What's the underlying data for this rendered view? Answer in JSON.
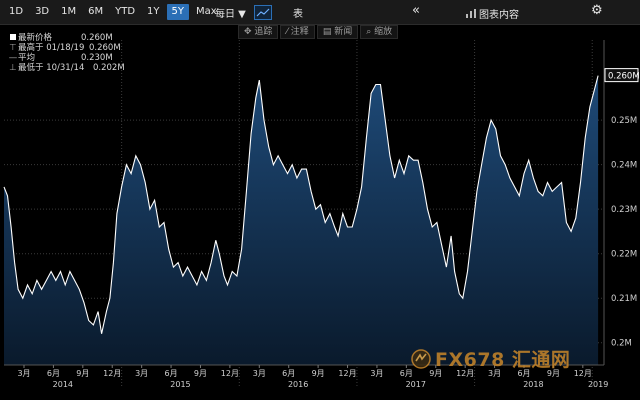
{
  "toolbar": {
    "ranges": [
      "1D",
      "3D",
      "1M",
      "6M",
      "YTD",
      "1Y",
      "5Y",
      "Max"
    ],
    "active_range": "5Y",
    "frequency": "每日 ▼",
    "table_label": "表",
    "collapse_label": "«",
    "chart_content_label": "图表内容",
    "settings_label": "⚙"
  },
  "subtoolbar": {
    "items": [
      "追踪",
      "注释",
      "新闻",
      "缩放"
    ]
  },
  "legend": {
    "rows": [
      {
        "label": "最新价格",
        "value": "0.260M"
      },
      {
        "label": "最高于 01/18/19",
        "value": "0.260M"
      },
      {
        "label": "平均",
        "value": "0.230M"
      },
      {
        "label": "最低于 10/31/14",
        "value": "0.202M"
      }
    ]
  },
  "watermark": {
    "text": "FX678 汇通网"
  },
  "colors": {
    "line": "#ffffff",
    "area_top": "#1e4a78",
    "area_bottom": "#0a1a2c",
    "active_tab": "#2b6fb6",
    "background": "#000000"
  },
  "chart_data": {
    "type": "area",
    "ylim": [
      0.195,
      0.268
    ],
    "y_ticks": [
      "0.2M",
      "0.21M",
      "0.22M",
      "0.23M",
      "0.24M",
      "0.25M"
    ],
    "y_tick_values": [
      0.2,
      0.21,
      0.22,
      0.23,
      0.24,
      0.25
    ],
    "last_value_label": "0.260M",
    "last_value": 0.26,
    "x_month_ticks": [
      {
        "label": "3月",
        "t": 2014.17
      },
      {
        "label": "6月",
        "t": 2014.42
      },
      {
        "label": "9月",
        "t": 2014.67
      },
      {
        "label": "12月",
        "t": 2014.92
      },
      {
        "label": "3月",
        "t": 2015.17
      },
      {
        "label": "6月",
        "t": 2015.42
      },
      {
        "label": "9月",
        "t": 2015.67
      },
      {
        "label": "12月",
        "t": 2015.92
      },
      {
        "label": "3月",
        "t": 2016.17
      },
      {
        "label": "6月",
        "t": 2016.42
      },
      {
        "label": "9月",
        "t": 2016.67
      },
      {
        "label": "12月",
        "t": 2016.92
      },
      {
        "label": "3月",
        "t": 2017.17
      },
      {
        "label": "6月",
        "t": 2017.42
      },
      {
        "label": "9月",
        "t": 2017.67
      },
      {
        "label": "12月",
        "t": 2017.92
      },
      {
        "label": "3月",
        "t": 2018.17
      },
      {
        "label": "6月",
        "t": 2018.42
      },
      {
        "label": "9月",
        "t": 2018.67
      },
      {
        "label": "12月",
        "t": 2018.92
      }
    ],
    "x_year_ticks": [
      {
        "label": "2014",
        "t": 2014.5
      },
      {
        "label": "2015",
        "t": 2015.5
      },
      {
        "label": "2016",
        "t": 2016.5
      },
      {
        "label": "2017",
        "t": 2017.5
      },
      {
        "label": "2018",
        "t": 2018.5
      },
      {
        "label": "2019",
        "t": 2019.05
      }
    ],
    "xlim": [
      2014.0,
      2019.1
    ],
    "series": [
      {
        "values": [
          [
            2014.0,
            0.235
          ],
          [
            2014.03,
            0.233
          ],
          [
            2014.06,
            0.226
          ],
          [
            2014.09,
            0.218
          ],
          [
            2014.12,
            0.212
          ],
          [
            2014.16,
            0.21
          ],
          [
            2014.2,
            0.213
          ],
          [
            2014.24,
            0.211
          ],
          [
            2014.28,
            0.214
          ],
          [
            2014.32,
            0.212
          ],
          [
            2014.36,
            0.214
          ],
          [
            2014.4,
            0.216
          ],
          [
            2014.44,
            0.214
          ],
          [
            2014.48,
            0.216
          ],
          [
            2014.52,
            0.213
          ],
          [
            2014.56,
            0.216
          ],
          [
            2014.6,
            0.214
          ],
          [
            2014.64,
            0.212
          ],
          [
            2014.68,
            0.209
          ],
          [
            2014.72,
            0.205
          ],
          [
            2014.76,
            0.204
          ],
          [
            2014.8,
            0.207
          ],
          [
            2014.83,
            0.202
          ],
          [
            2014.87,
            0.207
          ],
          [
            2014.9,
            0.21
          ],
          [
            2014.93,
            0.218
          ],
          [
            2014.96,
            0.229
          ],
          [
            2015.0,
            0.235
          ],
          [
            2015.04,
            0.24
          ],
          [
            2015.08,
            0.238
          ],
          [
            2015.12,
            0.242
          ],
          [
            2015.16,
            0.24
          ],
          [
            2015.2,
            0.236
          ],
          [
            2015.24,
            0.23
          ],
          [
            2015.28,
            0.232
          ],
          [
            2015.32,
            0.226
          ],
          [
            2015.36,
            0.227
          ],
          [
            2015.4,
            0.221
          ],
          [
            2015.44,
            0.217
          ],
          [
            2015.48,
            0.218
          ],
          [
            2015.52,
            0.215
          ],
          [
            2015.56,
            0.217
          ],
          [
            2015.6,
            0.215
          ],
          [
            2015.64,
            0.213
          ],
          [
            2015.68,
            0.216
          ],
          [
            2015.72,
            0.214
          ],
          [
            2015.76,
            0.218
          ],
          [
            2015.8,
            0.223
          ],
          [
            2015.83,
            0.22
          ],
          [
            2015.87,
            0.215
          ],
          [
            2015.9,
            0.213
          ],
          [
            2015.94,
            0.216
          ],
          [
            2015.98,
            0.215
          ],
          [
            2016.02,
            0.221
          ],
          [
            2016.06,
            0.234
          ],
          [
            2016.1,
            0.247
          ],
          [
            2016.14,
            0.255
          ],
          [
            2016.17,
            0.259
          ],
          [
            2016.21,
            0.25
          ],
          [
            2016.25,
            0.244
          ],
          [
            2016.29,
            0.24
          ],
          [
            2016.33,
            0.242
          ],
          [
            2016.37,
            0.24
          ],
          [
            2016.41,
            0.238
          ],
          [
            2016.45,
            0.24
          ],
          [
            2016.49,
            0.237
          ],
          [
            2016.53,
            0.239
          ],
          [
            2016.57,
            0.239
          ],
          [
            2016.61,
            0.234
          ],
          [
            2016.65,
            0.23
          ],
          [
            2016.69,
            0.231
          ],
          [
            2016.73,
            0.227
          ],
          [
            2016.77,
            0.229
          ],
          [
            2016.81,
            0.226
          ],
          [
            2016.84,
            0.224
          ],
          [
            2016.88,
            0.229
          ],
          [
            2016.92,
            0.226
          ],
          [
            2016.96,
            0.226
          ],
          [
            2017.0,
            0.23
          ],
          [
            2017.04,
            0.235
          ],
          [
            2017.08,
            0.246
          ],
          [
            2017.12,
            0.256
          ],
          [
            2017.16,
            0.258
          ],
          [
            2017.2,
            0.258
          ],
          [
            2017.24,
            0.25
          ],
          [
            2017.28,
            0.242
          ],
          [
            2017.32,
            0.237
          ],
          [
            2017.36,
            0.241
          ],
          [
            2017.4,
            0.238
          ],
          [
            2017.44,
            0.242
          ],
          [
            2017.48,
            0.241
          ],
          [
            2017.52,
            0.241
          ],
          [
            2017.56,
            0.236
          ],
          [
            2017.6,
            0.23
          ],
          [
            2017.64,
            0.226
          ],
          [
            2017.68,
            0.227
          ],
          [
            2017.72,
            0.222
          ],
          [
            2017.76,
            0.217
          ],
          [
            2017.8,
            0.224
          ],
          [
            2017.83,
            0.216
          ],
          [
            2017.87,
            0.211
          ],
          [
            2017.9,
            0.21
          ],
          [
            2017.94,
            0.216
          ],
          [
            2017.98,
            0.225
          ],
          [
            2018.02,
            0.234
          ],
          [
            2018.06,
            0.24
          ],
          [
            2018.1,
            0.246
          ],
          [
            2018.14,
            0.25
          ],
          [
            2018.18,
            0.248
          ],
          [
            2018.22,
            0.242
          ],
          [
            2018.26,
            0.24
          ],
          [
            2018.3,
            0.237
          ],
          [
            2018.34,
            0.235
          ],
          [
            2018.38,
            0.233
          ],
          [
            2018.42,
            0.238
          ],
          [
            2018.46,
            0.241
          ],
          [
            2018.5,
            0.237
          ],
          [
            2018.54,
            0.234
          ],
          [
            2018.58,
            0.233
          ],
          [
            2018.62,
            0.236
          ],
          [
            2018.66,
            0.234
          ],
          [
            2018.7,
            0.235
          ],
          [
            2018.74,
            0.236
          ],
          [
            2018.78,
            0.227
          ],
          [
            2018.82,
            0.225
          ],
          [
            2018.86,
            0.228
          ],
          [
            2018.9,
            0.236
          ],
          [
            2018.94,
            0.246
          ],
          [
            2018.98,
            0.253
          ],
          [
            2019.02,
            0.257
          ],
          [
            2019.05,
            0.26
          ]
        ]
      }
    ]
  }
}
